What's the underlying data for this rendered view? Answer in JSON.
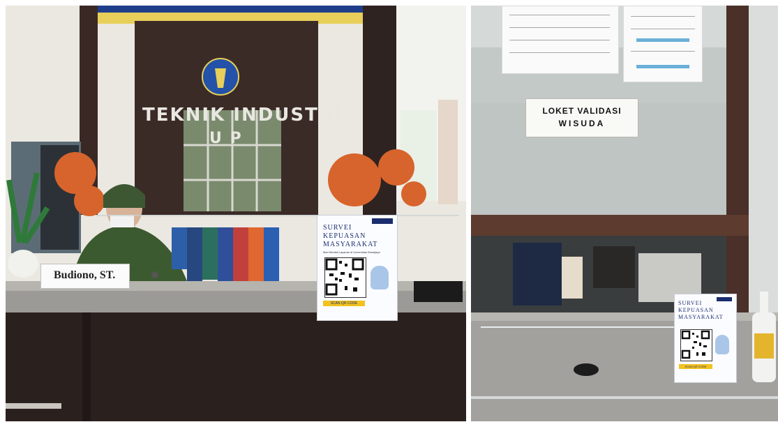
{
  "left_photo": {
    "department_sign": "TEKNIK INDUSTRI",
    "department_sign_sub": "U P",
    "nameplate": "Budiono, ST.",
    "survey_card": {
      "title_line1": "SURVEI",
      "title_line2": "KEPUASAN",
      "title_line3": "MASYARAKAT",
      "subtitle": "Mari Menilai Layanan di Universitas Brawijaya",
      "bottom_banner": "SCAN QR CODE"
    }
  },
  "right_photo": {
    "counter_sign_line1": "LOKET VALIDASI",
    "counter_sign_line2": "WISUDA",
    "survey_card": {
      "title_line1": "SURVEI",
      "title_line2": "KEPUASAN",
      "title_line3": "MASYARAKAT",
      "bottom_banner": "SCAN QR CODE"
    }
  },
  "colors": {
    "granite": "#9c9a96",
    "counter_dark": "#2a211f",
    "maple_orange": "#d7642c",
    "teacher_green": "#3c5a2f",
    "ub_blue": "#1a2d6e"
  }
}
